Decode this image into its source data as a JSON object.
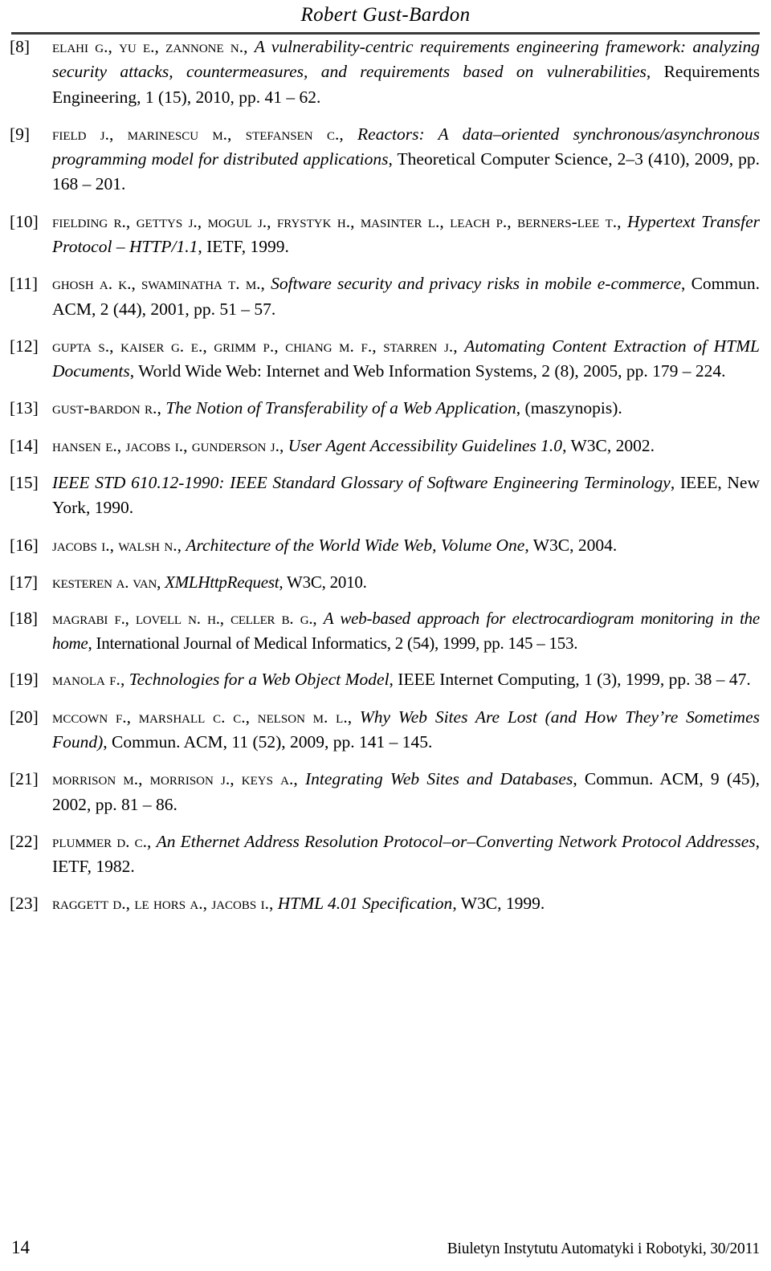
{
  "header": {
    "running_head": "Robert Gust-Bardon"
  },
  "references": [
    {
      "number": "[8]",
      "authors": "ELAHI G., YU E., ZANNONE N.",
      "title": "A vulnerability-centric requirements engineering framework: analyzing security attacks, countermeasures, and requirements based on vulnerabilities",
      "source": "Requirements Engineering, 1 (15), 2010, pp. 41 – 62."
    },
    {
      "number": "[9]",
      "authors": "FIELD J., MARINESCU M., STEFANSEN C.",
      "title": "Reactors: A data–oriented synchronous/asynchronous programming model for distributed applications",
      "source": "Theoretical Computer Science, 2–3 (410), 2009, pp. 168 – 201."
    },
    {
      "number": "[10]",
      "authors": "FIELDING R., GETTYS J., MOGUL J., FRYSTYK H., MASINTER L., LEACH P., BERNERS-LEE T.",
      "title": "Hypertext Transfer Protocol – HTTP/1.1",
      "source": "IETF, 1999."
    },
    {
      "number": "[11]",
      "authors": "GHOSH A. K., SWAMINATHA T. M.",
      "title": "Software security and privacy risks in mobile e-commerce",
      "source": "Commun. ACM, 2 (44), 2001, pp. 51 – 57."
    },
    {
      "number": "[12]",
      "authors": "GUPTA S., KAISER G. E., GRIMM P., CHIANG M. F., STARREN J.",
      "title": "Automating Content Extraction of HTML Documents",
      "source": "World Wide Web: Internet and Web Information Systems, 2 (8), 2005, pp. 179 – 224."
    },
    {
      "number": "[13]",
      "authors": "GUST-BARDON R.",
      "title": "The Notion of Transferability of a Web Application",
      "source": "(maszynopis)."
    },
    {
      "number": "[14]",
      "authors": "HANSEN E., JACOBS I., GUNDERSON J.",
      "title": "User Agent Accessibility Guidelines 1.0",
      "source": "W3C, 2002."
    },
    {
      "number": "[15]",
      "authors": "",
      "title": "IEEE STD 610.12-1990: IEEE Standard Glossary of Software Engineering Terminology",
      "source": "IEEE, New York, 1990."
    },
    {
      "number": "[16]",
      "authors": "JACOBS I., WALSH N.",
      "title": "Architecture of the World Wide Web, Volume One",
      "source": "W3C, 2004."
    },
    {
      "number": "[17]",
      "authors": "KESTEREN A. VAN",
      "title": "XMLHttpRequest",
      "source": "W3C, 2010."
    },
    {
      "number": "[18]",
      "authors": "MAGRABI F., LOVELL N. H., CELLER B. G.",
      "title": "A web-based approach for electrocardiogram monitoring in the home",
      "source": "International Journal of Medical Informatics, 2 (54), 1999, pp. 145 – 153."
    },
    {
      "number": "[19]",
      "authors": "MANOLA F.",
      "title": "Technologies for a Web Object Model",
      "source": "IEEE Internet Computing, 1 (3), 1999, pp. 38 – 47."
    },
    {
      "number": "[20]",
      "authors": "MCCOWN F., MARSHALL C. C., NELSON M. L.",
      "title": "Why Web Sites Are Lost (and How They’re Sometimes Found)",
      "source": "Commun. ACM, 11 (52), 2009, pp. 141 – 145."
    },
    {
      "number": "[21]",
      "authors": "MORRISON M., MORRISON J., KEYS A.",
      "title": "Integrating Web Sites and Databases",
      "source": "Commun. ACM, 9 (45), 2002, pp. 81 – 86."
    },
    {
      "number": "[22]",
      "authors": "PLUMMER D. C.",
      "title": "An Ethernet Address Resolution Protocol–or–Converting Network Protocol Addresses",
      "source": "IETF, 1982."
    },
    {
      "number": "[23]",
      "authors": "RAGGETT D., LE HORS A., JACOBS I.",
      "title": "HTML 4.01 Specification",
      "source": "W3C, 1999."
    }
  ],
  "footer": {
    "page_number": "14",
    "publication": "Biuletyn Instytutu Automatyki i Robotyki, 30/2011"
  }
}
